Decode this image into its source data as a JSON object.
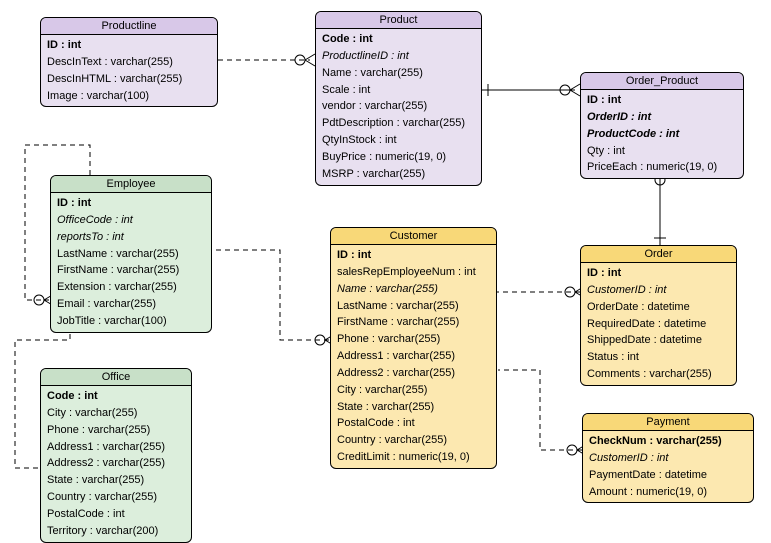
{
  "entities": {
    "productline": {
      "title": "Productline",
      "attrs": [
        {
          "text": "ID : int",
          "pk": true
        },
        {
          "text": "DescInText : varchar(255)"
        },
        {
          "text": "DescInHTML : varchar(255)"
        },
        {
          "text": "Image : varchar(100)"
        }
      ]
    },
    "product": {
      "title": "Product",
      "attrs": [
        {
          "text": "Code : int",
          "pk": true
        },
        {
          "text": "ProductlineID : int",
          "fk": true
        },
        {
          "text": "Name : varchar(255)"
        },
        {
          "text": "Scale : int"
        },
        {
          "text": "vendor : varchar(255)"
        },
        {
          "text": "PdtDescription : varchar(255)"
        },
        {
          "text": "QtyInStock : int"
        },
        {
          "text": "BuyPrice : numeric(19, 0)"
        },
        {
          "text": "MSRP : varchar(255)"
        }
      ]
    },
    "order_product": {
      "title": "Order_Product",
      "attrs": [
        {
          "text": "ID : int",
          "pk": true
        },
        {
          "text": "OrderID : int",
          "pk": true,
          "fk": true
        },
        {
          "text": "ProductCode : int",
          "pk": true,
          "fk": true
        },
        {
          "text": "Qty : int"
        },
        {
          "text": "PriceEach : numeric(19, 0)"
        }
      ]
    },
    "employee": {
      "title": "Employee",
      "attrs": [
        {
          "text": "ID : int",
          "pk": true
        },
        {
          "text": "OfficeCode : int",
          "fk": true
        },
        {
          "text": "reportsTo : int",
          "fk": true
        },
        {
          "text": "LastName : varchar(255)"
        },
        {
          "text": "FirstName : varchar(255)"
        },
        {
          "text": "Extension : varchar(255)"
        },
        {
          "text": "Email : varchar(255)"
        },
        {
          "text": "JobTitle : varchar(100)"
        }
      ]
    },
    "customer": {
      "title": "Customer",
      "attrs": [
        {
          "text": "ID : int",
          "pk": true
        },
        {
          "text": "salesRepEmployeeNum : int"
        },
        {
          "text": "Name : varchar(255)",
          "fk": true
        },
        {
          "text": "LastName : varchar(255)"
        },
        {
          "text": "FirstName : varchar(255)"
        },
        {
          "text": "Phone : varchar(255)"
        },
        {
          "text": "Address1 : varchar(255)"
        },
        {
          "text": "Address2 : varchar(255)"
        },
        {
          "text": "City : varchar(255)"
        },
        {
          "text": "State : varchar(255)"
        },
        {
          "text": "PostalCode : int"
        },
        {
          "text": "Country : varchar(255)"
        },
        {
          "text": "CreditLimit : numeric(19, 0)"
        }
      ]
    },
    "order": {
      "title": "Order",
      "attrs": [
        {
          "text": "ID : int",
          "pk": true
        },
        {
          "text": "CustomerID : int",
          "fk": true
        },
        {
          "text": "OrderDate : datetime"
        },
        {
          "text": "RequiredDate : datetime"
        },
        {
          "text": "ShippedDate : datetime"
        },
        {
          "text": "Status : int"
        },
        {
          "text": "Comments : varchar(255)"
        }
      ]
    },
    "office": {
      "title": "Office",
      "attrs": [
        {
          "text": "Code : int",
          "pk": true
        },
        {
          "text": "City : varchar(255)"
        },
        {
          "text": "Phone : varchar(255)"
        },
        {
          "text": "Address1 : varchar(255)"
        },
        {
          "text": "Address2 : varchar(255)"
        },
        {
          "text": "State : varchar(255)"
        },
        {
          "text": "Country : varchar(255)"
        },
        {
          "text": "PostalCode : int"
        },
        {
          "text": "Territory : varchar(200)"
        }
      ]
    },
    "payment": {
      "title": "Payment",
      "attrs": [
        {
          "text": "CheckNum : varchar(255)",
          "pk": true
        },
        {
          "text": "CustomerID : int",
          "fk": true
        },
        {
          "text": "PaymentDate : datetime"
        },
        {
          "text": "Amount : numeric(19, 0)"
        }
      ]
    }
  }
}
